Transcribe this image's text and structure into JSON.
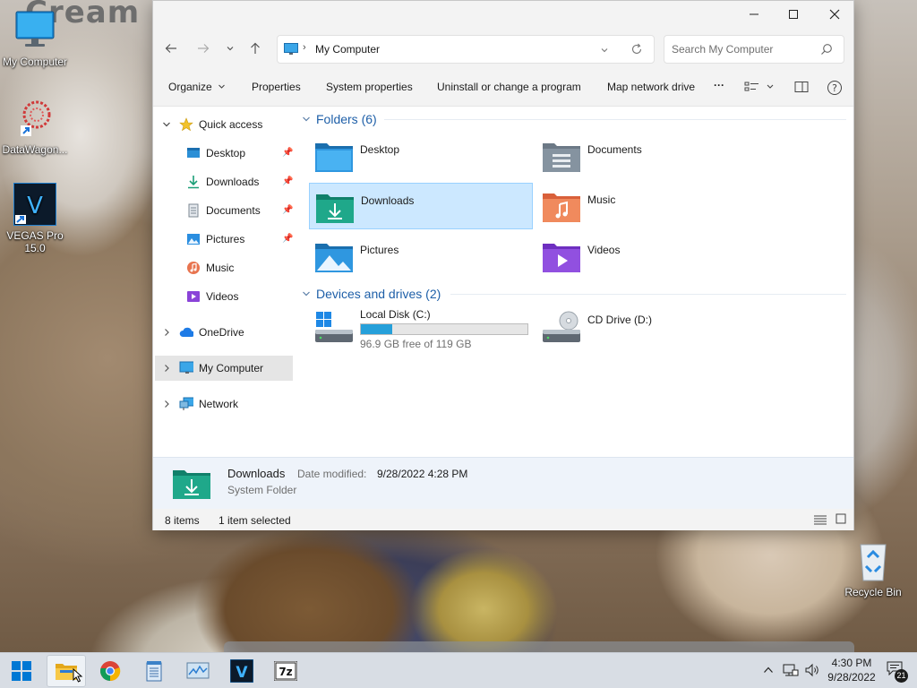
{
  "desktop": {
    "wallpaper_text": "Cream",
    "icons": [
      {
        "label": "My Computer"
      },
      {
        "label": "DataWagon..."
      },
      {
        "label": "VEGAS Pro 15.0"
      },
      {
        "label": "Recycle Bin"
      }
    ]
  },
  "window": {
    "address": {
      "current": "My Computer"
    },
    "search": {
      "placeholder": "Search My Computer"
    },
    "commands": {
      "organize": "Organize",
      "properties": "Properties",
      "system_properties": "System properties",
      "uninstall": "Uninstall or change a program",
      "map_network": "Map network drive",
      "more": "···"
    },
    "nav": {
      "quick_access": "Quick access",
      "items": [
        {
          "label": "Desktop",
          "pinned": true
        },
        {
          "label": "Downloads",
          "pinned": true
        },
        {
          "label": "Documents",
          "pinned": true
        },
        {
          "label": "Pictures",
          "pinned": true
        },
        {
          "label": "Music",
          "pinned": false
        },
        {
          "label": "Videos",
          "pinned": false
        }
      ],
      "onedrive": "OneDrive",
      "my_computer": "My Computer",
      "network": "Network"
    },
    "content": {
      "folders_header": "Folders (6)",
      "folders": [
        {
          "label": "Desktop"
        },
        {
          "label": "Documents"
        },
        {
          "label": "Downloads",
          "selected": true
        },
        {
          "label": "Music"
        },
        {
          "label": "Pictures"
        },
        {
          "label": "Videos"
        }
      ],
      "drives_header": "Devices and drives (2)",
      "drives": [
        {
          "label": "Local Disk (C:)",
          "free_text": "96.9 GB free of 119 GB",
          "used_fraction": 0.19
        },
        {
          "label": "CD Drive (D:)"
        }
      ]
    },
    "details": {
      "name": "Downloads",
      "date_label": "Date modified:",
      "date_value": "9/28/2022 4:28 PM",
      "type": "System Folder"
    },
    "status": {
      "items": "8 items",
      "selected": "1 item selected"
    }
  },
  "taskbar": {
    "time": "4:30 PM",
    "date": "9/28/2022",
    "notifications": "21",
    "apps": [
      "start",
      "file-explorer",
      "chrome",
      "notepad",
      "resource-monitor",
      "vegas-pro",
      "7-zip"
    ]
  },
  "colors": {
    "accent": "#0067c0",
    "selection": "#cce8ff",
    "header_blue": "#1e5fa8",
    "drive_bar": "#26a0da"
  }
}
